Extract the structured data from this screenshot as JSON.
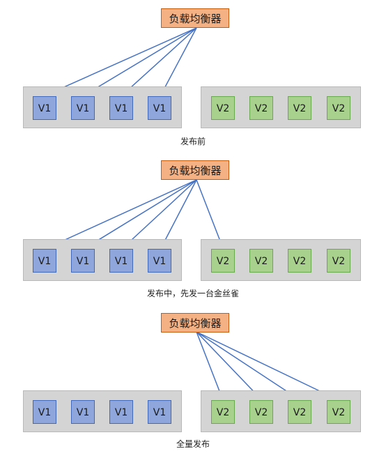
{
  "panels": [
    {
      "load_balancer": "负载均衡器",
      "v1_nodes": [
        "V1",
        "V1",
        "V1",
        "V1"
      ],
      "v2_nodes": [
        "V2",
        "V2",
        "V2",
        "V2"
      ],
      "caption": "发布前"
    },
    {
      "load_balancer": "负载均衡器",
      "v1_nodes": [
        "V1",
        "V1",
        "V1",
        "V1"
      ],
      "v2_nodes": [
        "V2",
        "V2",
        "V2",
        "V2"
      ],
      "caption": "发布中，先发一台金丝雀"
    },
    {
      "load_balancer": "负载均衡器",
      "v1_nodes": [
        "V1",
        "V1",
        "V1",
        "V1"
      ],
      "v2_nodes": [
        "V2",
        "V2",
        "V2",
        "V2"
      ],
      "caption": "全量发布"
    }
  ],
  "colors": {
    "load_balancer_fill": "#f4b183",
    "v1_fill": "#8ea6dc",
    "v2_fill": "#a9d18e",
    "group_fill": "#d4d4d4",
    "arrow": "#4472c4"
  }
}
